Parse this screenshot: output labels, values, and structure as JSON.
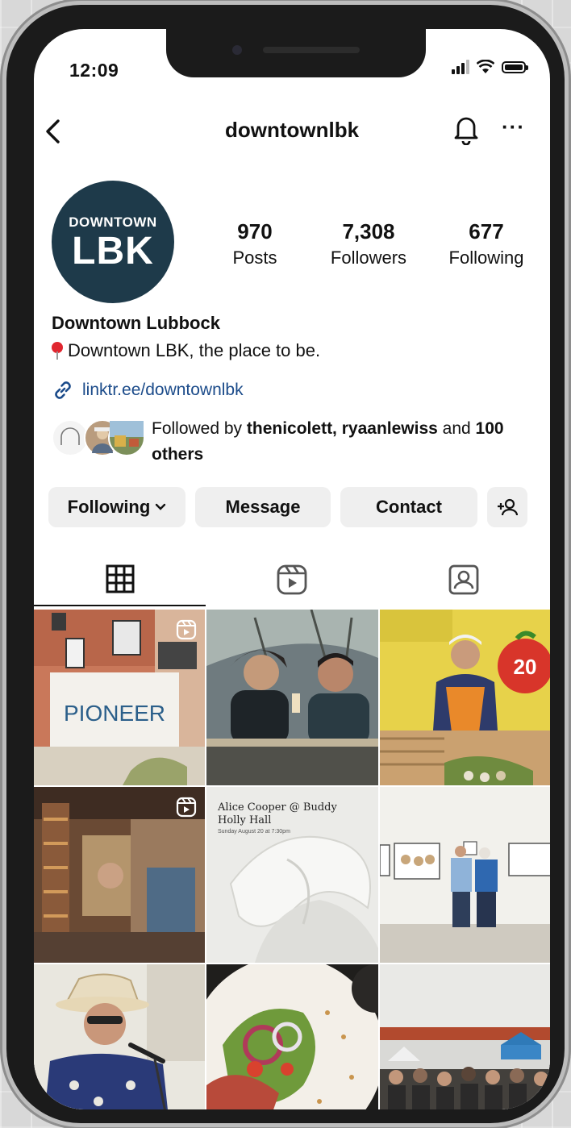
{
  "status": {
    "time": "12:09"
  },
  "header": {
    "username": "downtownlbk"
  },
  "profile": {
    "avatar_small": "DOWNTOWN",
    "avatar_big": "LBK",
    "full_name": "Downtown Lubbock",
    "bio": "Downtown LBK, the place to be.",
    "link": "linktr.ee/downtownlbk",
    "followed_by_prefix": "Followed by ",
    "followed_by_names": "thenicolett, ryaanlewiss",
    "followed_by_and": " and ",
    "followed_by_others": "100 others"
  },
  "stats": [
    {
      "value": "970",
      "label": "Posts"
    },
    {
      "value": "7,308",
      "label": "Followers"
    },
    {
      "value": "677",
      "label": "Following"
    }
  ],
  "actions": {
    "following": "Following",
    "message": "Message",
    "contact": "Contact"
  },
  "posts": {
    "p2_title": "Alice Cooper @ Buddy Holly Hall",
    "p2_sub": "Sunday August 20 at 7:30pm",
    "p1_sign": "PIONEER",
    "p3_sign": "20"
  }
}
